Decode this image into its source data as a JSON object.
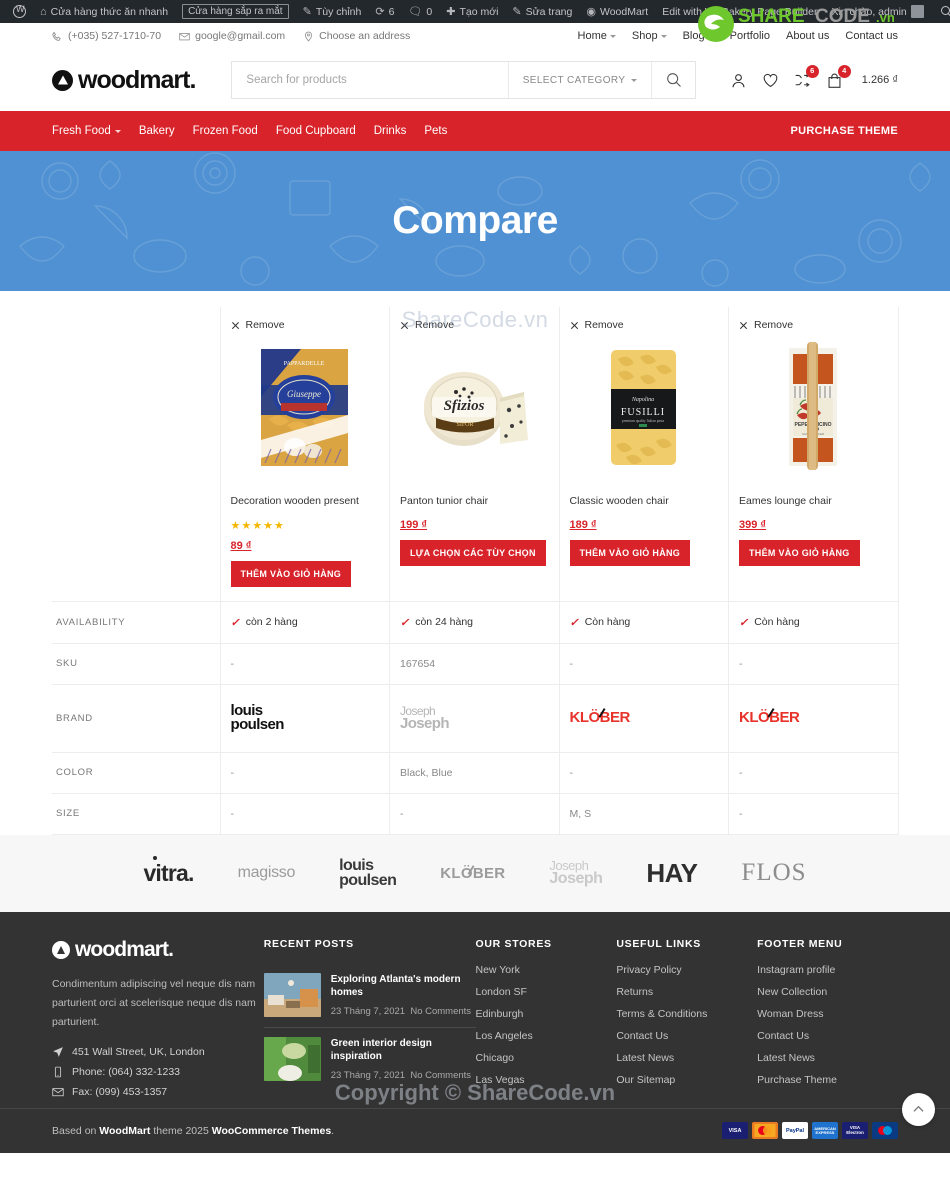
{
  "adminbar": {
    "items": [
      {
        "label": "Cửa hàng thức ăn nhanh",
        "icon": "home-icon"
      },
      {
        "label": "Cửa hàng sắp ra mắt",
        "icon": "none",
        "boxed": true
      },
      {
        "label": "Tùy chỉnh",
        "icon": "pencil-icon"
      },
      {
        "label": "6",
        "icon": "updates-icon"
      },
      {
        "label": "0",
        "icon": "comment-icon"
      },
      {
        "label": "Tạo mới",
        "icon": "plus-icon"
      },
      {
        "label": "Sửa trang",
        "icon": "pencil-icon"
      },
      {
        "label": "WoodMart",
        "icon": "woodmart-icon"
      },
      {
        "label": "Edit with WPBakery Page Builder",
        "icon": "none"
      }
    ],
    "greeting": "Xin chào, admin"
  },
  "topbar": {
    "phone": "(+035) 527-1710-70",
    "email": "google@gmail.com",
    "address": "Choose an address",
    "nav": [
      {
        "label": "Home",
        "has_caret": true
      },
      {
        "label": "Shop",
        "has_caret": true
      },
      {
        "label": "Blog",
        "has_caret": true
      },
      {
        "label": "Portfolio",
        "has_caret": false
      },
      {
        "label": "About us",
        "has_caret": false
      },
      {
        "label": "Contact us",
        "has_caret": false
      }
    ]
  },
  "header": {
    "logo_text": "woodmart.",
    "search_placeholder": "Search for products",
    "search_value": "",
    "select_category": "SELECT CATEGORY",
    "compare_badge": "6",
    "cart_badge": "4",
    "cart_total": "1.266 ₫"
  },
  "mainnav": {
    "items": [
      {
        "label": "Fresh Food",
        "has_caret": true
      },
      {
        "label": "Bakery",
        "has_caret": false
      },
      {
        "label": "Frozen Food",
        "has_caret": false
      },
      {
        "label": "Food Cupboard",
        "has_caret": false
      },
      {
        "label": "Drinks",
        "has_caret": false
      },
      {
        "label": "Pets",
        "has_caret": false
      }
    ],
    "purchase_label": "PURCHASE THEME"
  },
  "hero": {
    "title": "Compare",
    "bg_color": "#4f91d2"
  },
  "watermarks": {
    "top": "ShareCode.vn",
    "bottom": "Copyright © ShareCode.vn",
    "logo_text": "SHARECODE.vn"
  },
  "compare": {
    "remove_label": "Remove",
    "products": [
      {
        "title": "Decoration wooden present",
        "price": "89 ₫",
        "rating": 5,
        "show_rating": true,
        "button": "THÊM VÀO GIỎ HÀNG",
        "image": "pasta-box-blue"
      },
      {
        "title": "Panton tunior chair",
        "price": "199 ₫",
        "rating": 0,
        "show_rating": false,
        "button": "LỰA CHỌN CÁC TÙY CHỌN",
        "image": "cheese-wheel"
      },
      {
        "title": "Classic wooden chair",
        "price": "189 ₫",
        "rating": 0,
        "show_rating": false,
        "button": "THÊM VÀO GIỎ HÀNG",
        "image": "fusilli-pack"
      },
      {
        "title": "Eames lounge chair",
        "price": "399 ₫",
        "rating": 0,
        "show_rating": false,
        "button": "THÊM VÀO GIỎ HÀNG",
        "image": "peperoncino-pack"
      }
    ],
    "rows": [
      {
        "label": "AVAILABILITY",
        "type": "stock",
        "values": [
          "còn 2 hàng",
          "còn 24 hàng",
          "Còn hàng",
          "Còn hàng"
        ]
      },
      {
        "label": "SKU",
        "type": "text",
        "values": [
          "-",
          "167654",
          "-",
          "-"
        ]
      },
      {
        "label": "BRAND",
        "type": "brand",
        "values": [
          "louis poulsen",
          "Joseph Joseph",
          "KLÖBER",
          "KLÖBER"
        ]
      },
      {
        "label": "COLOR",
        "type": "text",
        "values": [
          "-",
          "Black, Blue",
          "-",
          "-"
        ]
      },
      {
        "label": "SIZE",
        "type": "text",
        "values": [
          "-",
          "-",
          "M, S",
          "-"
        ]
      }
    ]
  },
  "brandstrip": {
    "brands": [
      "vitra.",
      "magisso",
      "louis poulsen",
      "KLÖBER",
      "Joseph Joseph",
      "HAY",
      "FLOS"
    ]
  },
  "footer": {
    "logo_text": "woodmart.",
    "description": "Condimentum adipiscing vel neque dis nam parturient orci at scelerisque neque dis nam parturient.",
    "address": "451 Wall Street, UK, London",
    "phone": "Phone: (064) 332-1233",
    "fax": "Fax: (099) 453-1357",
    "recent_posts_title": "RECENT POSTS",
    "posts": [
      {
        "title": "Exploring Atlanta's modern homes",
        "date": "23 Tháng 7, 2021",
        "comments": "No Comments"
      },
      {
        "title": "Green interior design inspiration",
        "date": "23 Tháng 7, 2021",
        "comments": "No Comments"
      }
    ],
    "stores_title": "OUR STORES",
    "stores": [
      "New York",
      "London SF",
      "Edinburgh",
      "Los Angeles",
      "Chicago",
      "Las Vegas"
    ],
    "links_title": "USEFUL LINKS",
    "links": [
      "Privacy Policy",
      "Returns",
      "Terms & Conditions",
      "Contact Us",
      "Latest News",
      "Our Sitemap"
    ],
    "menu_title": "FOOTER MENU",
    "menu": [
      "Instagram profile",
      "New Collection",
      "Woman Dress",
      "Contact Us",
      "Latest News",
      "Purchase Theme"
    ]
  },
  "bottombar": {
    "copyright_pre": "Based on ",
    "copyright_b1": "WoodMart",
    "copyright_mid": " theme 2025 ",
    "copyright_b2": "WooCommerce Themes",
    "copyright_end": ".",
    "payments": [
      "VISA",
      "MasterCard",
      "PayPal",
      "AMERICAN EXPRESS",
      "VISA Electron",
      "Maestro"
    ]
  },
  "colors": {
    "brand_red": "#d8232a",
    "hero_blue": "#4f91d2",
    "footer_dark": "#333333",
    "admin_dark": "#23282d"
  }
}
